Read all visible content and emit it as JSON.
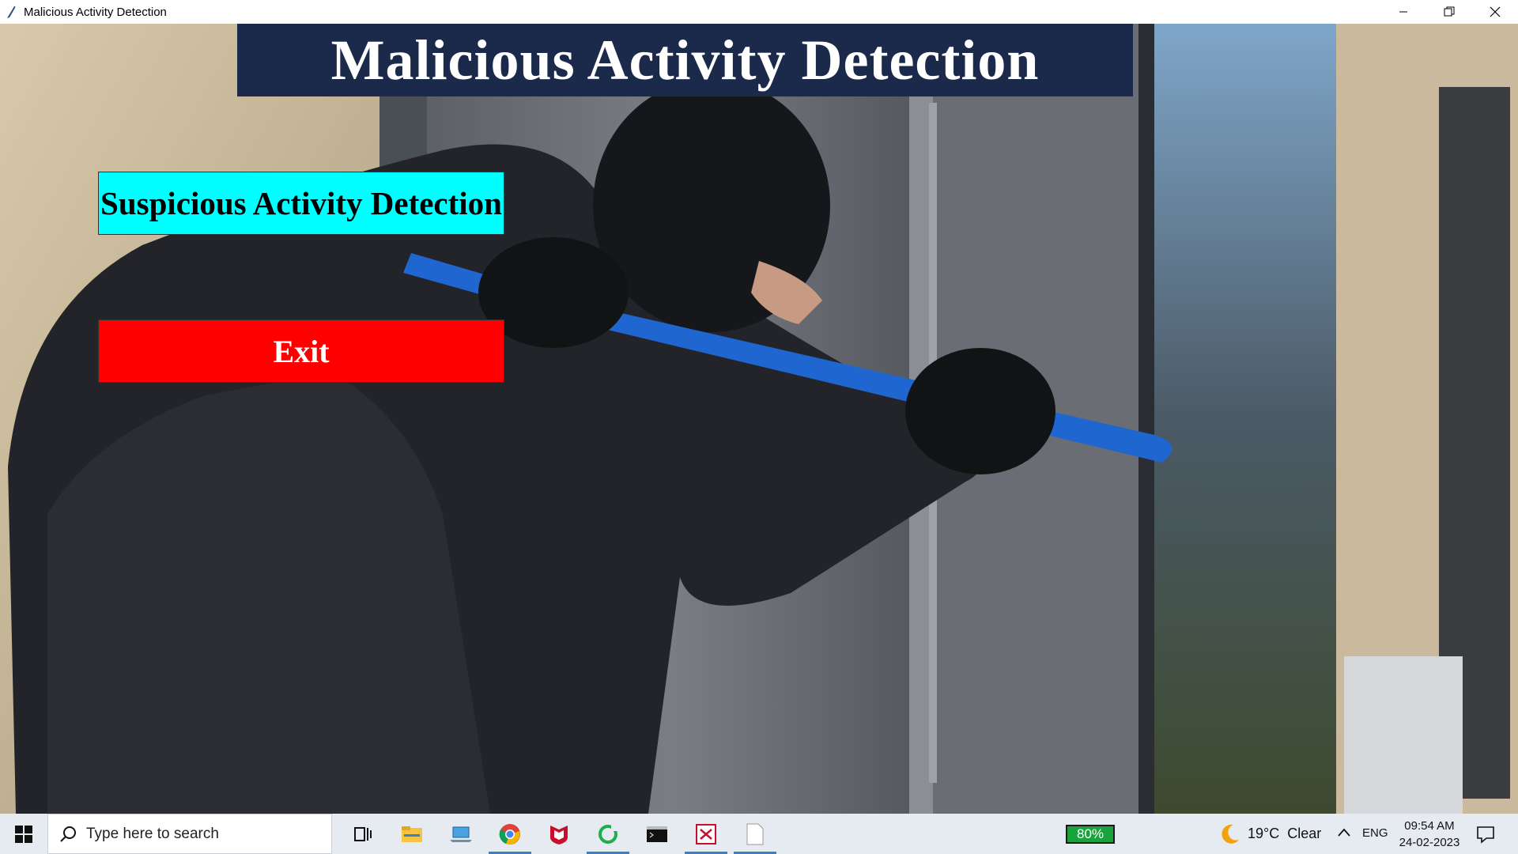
{
  "window": {
    "title": "Malicious Activity Detection",
    "controls": [
      "minimize-icon",
      "restore-icon",
      "close-icon"
    ]
  },
  "app": {
    "banner_title": "Malicious Activity Detection",
    "detect_button": "Suspicious Activity Detection",
    "exit_button": "Exit",
    "background_image": "burglar prying a door with a blue crowbar",
    "colors": {
      "banner_bg": "#1b2a4b",
      "detect_button_bg": "#00ffff",
      "exit_button_bg": "#ff0000"
    }
  },
  "taskbar": {
    "search_placeholder": "Type here to search",
    "apps": [
      {
        "name": "task-view-icon"
      },
      {
        "name": "file-explorer-icon"
      },
      {
        "name": "laptop-icon"
      },
      {
        "name": "chrome-icon"
      },
      {
        "name": "mcafee-icon"
      },
      {
        "name": "refresh-app-icon"
      },
      {
        "name": "terminal-icon"
      },
      {
        "name": "photo-app-icon"
      },
      {
        "name": "blank-document-icon"
      }
    ],
    "battery": "80%",
    "weather_temp": "19°C",
    "weather_condition": "Clear",
    "language": "ENG",
    "time": "09:54 AM",
    "date": "24-02-2023"
  }
}
